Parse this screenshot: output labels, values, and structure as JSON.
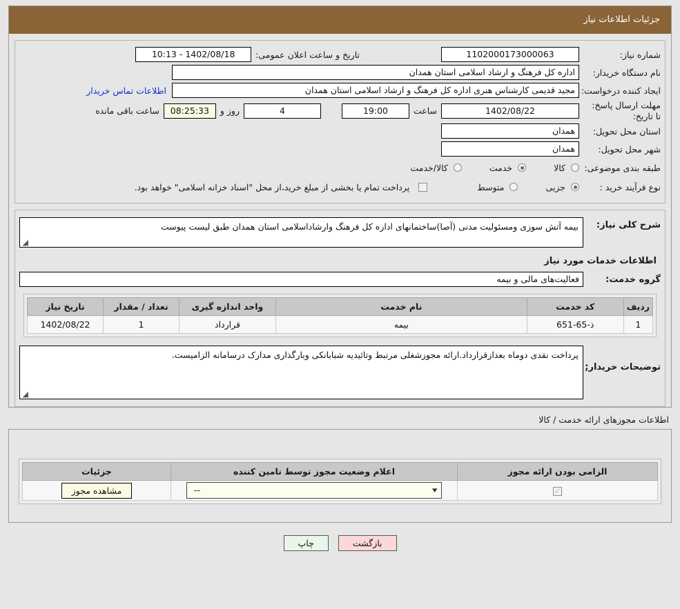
{
  "header": {
    "title": "جزئیات اطلاعات نیاز"
  },
  "form": {
    "need_number_label": "شماره نیاز:",
    "need_number_value": "1102000173000063",
    "announce_label": "تاریخ و ساعت اعلان عمومی:",
    "announce_value": "1402/08/18 - 10:13",
    "buyer_org_label": "نام دستگاه خریدار:",
    "buyer_org_value": "اداره کل فرهنگ و ارشاد اسلامی استان همدان",
    "creator_label": "ایجاد کننده درخواست:",
    "creator_value": "مجید قدیمی کارشناس هنری اداره کل فرهنگ و ارشاد اسلامی استان همدان",
    "contact_link": "اطلاعات تماس خریدار",
    "deadline_label": "مهلت ارسال پاسخ: تا تاریخ:",
    "deadline_date": "1402/08/22",
    "time_label": "ساعت",
    "deadline_time": "19:00",
    "days_value": "4",
    "days_label": "روز و",
    "countdown_value": "08:25:33",
    "countdown_label": "ساعت باقی مانده",
    "province_label": "استان محل تحویل:",
    "province_value": "همدان",
    "city_label": "شهر محل تحویل:",
    "city_value": "همدان",
    "classification_label": "طبقه بندی موضوعی:",
    "classification_options": [
      {
        "label": "کالا",
        "selected": false
      },
      {
        "label": "خدمت",
        "selected": true
      },
      {
        "label": "کالا/خدمت",
        "selected": false
      }
    ],
    "process_label": "نوع فرآیند خرید :",
    "process_options": [
      {
        "label": "جزیی",
        "selected": true
      },
      {
        "label": "متوسط",
        "selected": false
      }
    ],
    "treasury_checked": false,
    "treasury_note": "پرداخت تمام یا بخشی از مبلغ خرید،از محل \"اسناد خزانه اسلامی\" خواهد بود."
  },
  "description": {
    "label": "شرح کلی نیاز:",
    "value": "بیمه آتش سوزی ومسئولیت مدنی (آصا)ساختمانهای اداره کل فرهنگ وارشاداسلامی استان همدان طبق لیست پیوست"
  },
  "services": {
    "section_title": "اطلاعات خدمات مورد نیاز",
    "group_label": "گروه خدمت:",
    "group_value": "فعالیت‌های مالی و بیمه",
    "columns": [
      "ردیف",
      "کد خدمت",
      "نام خدمت",
      "واحد اندازه گیری",
      "تعداد / مقدار",
      "تاریخ نیاز"
    ],
    "rows": [
      [
        "1",
        "ذ-65-651",
        "بیمه",
        "قرارداد",
        "1",
        "1402/08/22"
      ]
    ]
  },
  "buyer_notes": {
    "label": "توضیحات خریدار;",
    "value": "پرداخت نقدی دوماه بعدازقرارداد.ارائه مجوزشغلی مرتبط وتائیدیه شبابانکی وبارگذاری مدارک درسامانه الزامیست."
  },
  "licenses": {
    "section_title": "اطلاعات مجوزهای ارائه خدمت / کالا",
    "columns": [
      "الزامی بودن ارائه مجوز",
      "اعلام وضعیت مجوز توسط تامین کننده",
      "جزئیات"
    ],
    "row": {
      "required_checked": true,
      "status_value": "--",
      "details_button": "مشاهده مجوز"
    }
  },
  "footer": {
    "print_label": "چاپ",
    "back_label": "بازگشت"
  },
  "colors": {
    "title_bar": "#8a6437",
    "link": "#1230d8",
    "print_button": "#e9f7e9",
    "back_button": "#fbd9d9",
    "yellow_field": "#fbfbe4"
  }
}
